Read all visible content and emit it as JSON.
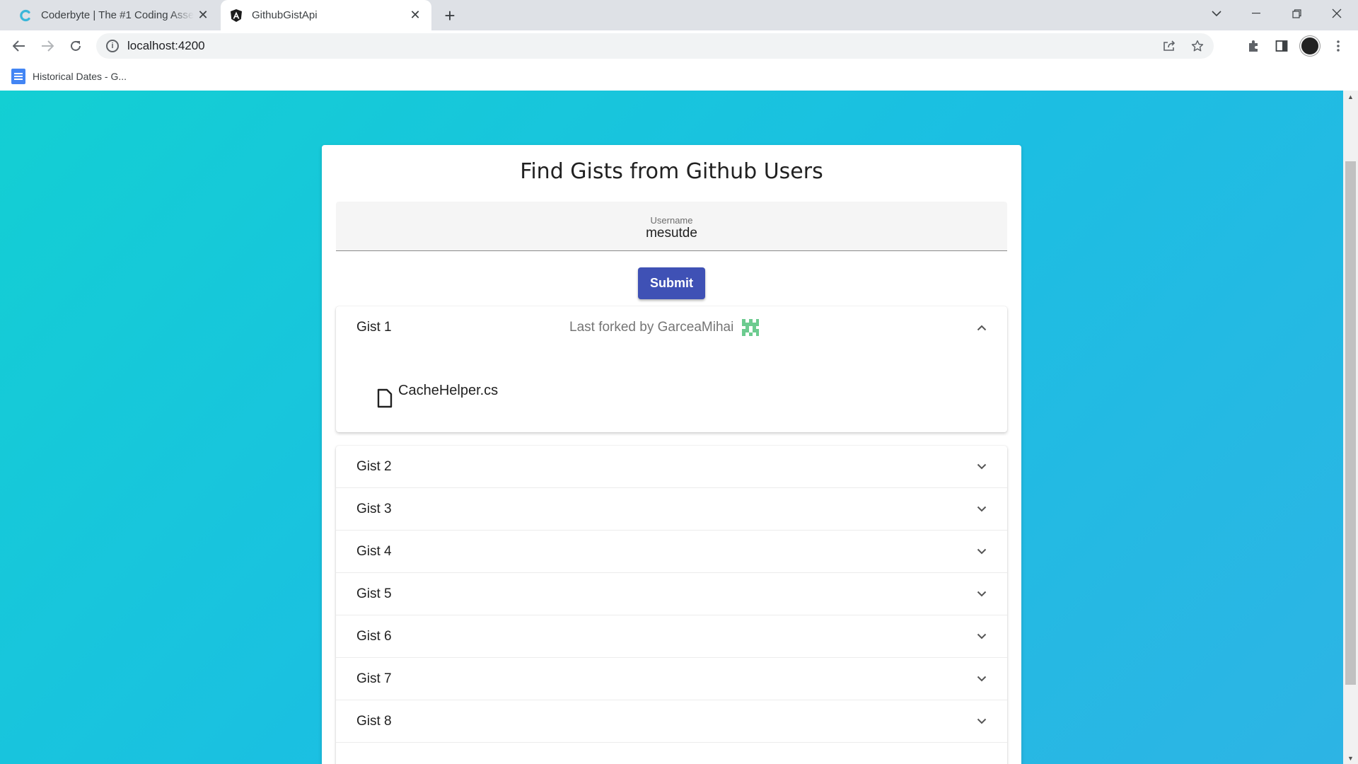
{
  "browser": {
    "tabs": [
      {
        "title": "Coderbyte | The #1 Coding Assessment",
        "favicon": "coderbyte-icon",
        "active": false
      },
      {
        "title": "GithubGistApi",
        "favicon": "angular-icon",
        "active": true
      }
    ],
    "url": "localhost:4200",
    "bookmarks": [
      {
        "label": "Historical Dates - G...",
        "icon": "google-docs-icon"
      }
    ]
  },
  "app": {
    "title": "Find Gists from Github Users",
    "username_label": "Username",
    "username_value": "mesutde",
    "submit_label": "Submit",
    "gists": [
      {
        "title": "Gist 1",
        "expanded": true,
        "forked_text": "Last forked by GarceaMihai",
        "files": [
          "CacheHelper.cs"
        ]
      },
      {
        "title": "Gist 2",
        "expanded": false
      },
      {
        "title": "Gist 3",
        "expanded": false
      },
      {
        "title": "Gist 4",
        "expanded": false
      },
      {
        "title": "Gist 5",
        "expanded": false
      },
      {
        "title": "Gist 6",
        "expanded": false
      },
      {
        "title": "Gist 7",
        "expanded": false
      },
      {
        "title": "Gist 8",
        "expanded": false
      }
    ]
  },
  "colors": {
    "background_gradient_start": "#13cfd3",
    "background_gradient_end": "#2db4e4",
    "primary_button": "#3f51b5",
    "identicon": "#6ccb8f"
  }
}
